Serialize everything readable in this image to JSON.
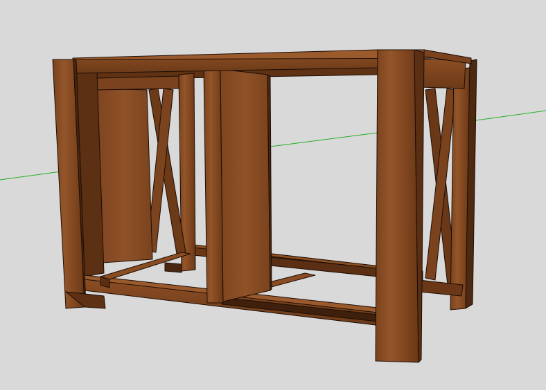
{
  "app": {
    "view": "3d-model-viewport"
  },
  "scene": {
    "background_color": "#d9d9d9",
    "model": {
      "name": "wooden-cabinet-frame",
      "wood_light": "#8a4f24",
      "wood_mid": "#6e3c18",
      "wood_dark": "#4a2711",
      "wood_shadow": "#3a1e0c",
      "edge_color": "#1c0d05"
    },
    "axes": {
      "green_axis_color": "#22b022"
    }
  }
}
